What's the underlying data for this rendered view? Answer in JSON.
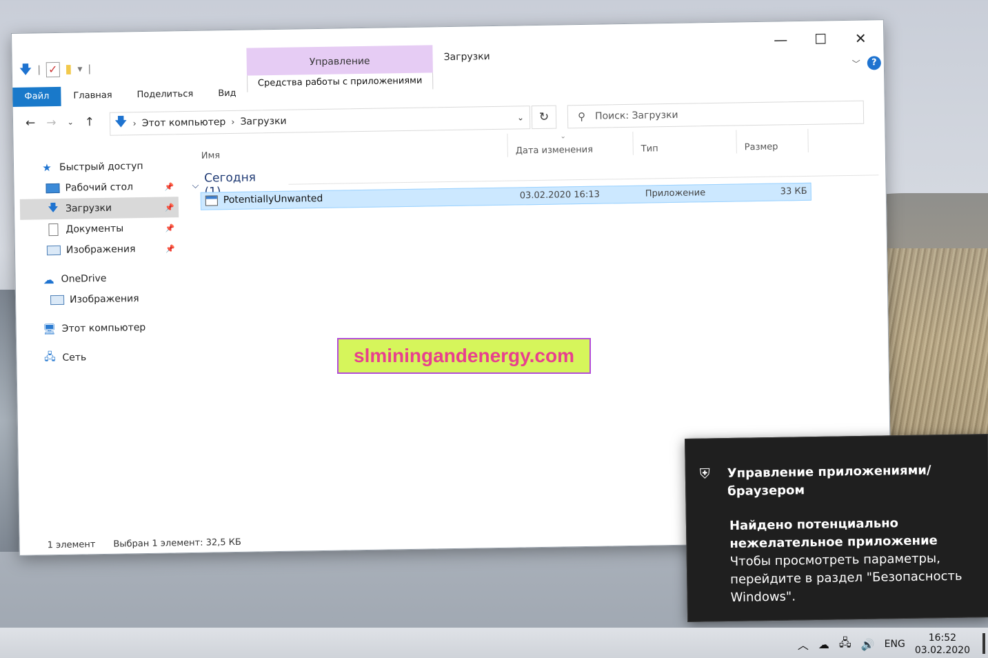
{
  "window": {
    "title": "Загрузки",
    "context_tab": "Управление",
    "context_subtab": "Средства работы с приложениями",
    "controls": {
      "minimize": "—",
      "maximize": "☐",
      "close": "✕"
    },
    "help": "?"
  },
  "menu": {
    "file": "Файл",
    "home": "Главная",
    "share": "Поделиться",
    "view": "Вид"
  },
  "address": {
    "crumbs": [
      "Этот компьютер",
      "Загрузки"
    ],
    "search_placeholder": "Поиск: Загрузки"
  },
  "sidebar": {
    "quick_access": "Быстрый доступ",
    "items": [
      {
        "label": "Рабочий стол"
      },
      {
        "label": "Загрузки"
      },
      {
        "label": "Документы"
      },
      {
        "label": "Изображения"
      }
    ],
    "onedrive": "OneDrive",
    "onedrive_images": "Изображения",
    "this_pc": "Этот компьютер",
    "network": "Сеть"
  },
  "columns": {
    "name": "Имя",
    "date": "Дата изменения",
    "type": "Тип",
    "size": "Размер"
  },
  "group": {
    "label": "Сегодня (1)"
  },
  "file": {
    "name": "PotentiallyUnwanted",
    "date": "03.02.2020 16:13",
    "type": "Приложение",
    "size": "33 КБ"
  },
  "status": {
    "count": "1 элемент",
    "selected": "Выбран 1 элемент: 32,5 КБ"
  },
  "watermark": "slminingandenergy.com",
  "toast": {
    "title": "Управление приложениями/ браузером",
    "heading": "Найдено потенциально нежелательное приложение",
    "body": "Чтобы просмотреть параметры, перейдите в раздел \"Безопасность Windows\"."
  },
  "taskbar": {
    "lang": "ENG",
    "time": "16:52",
    "date": "03.02.2020"
  },
  "colors": {
    "accent": "#1979ca",
    "selection": "#cce8ff",
    "context_tab": "#e6ccf4",
    "toast_bg": "#1f1f1f"
  }
}
